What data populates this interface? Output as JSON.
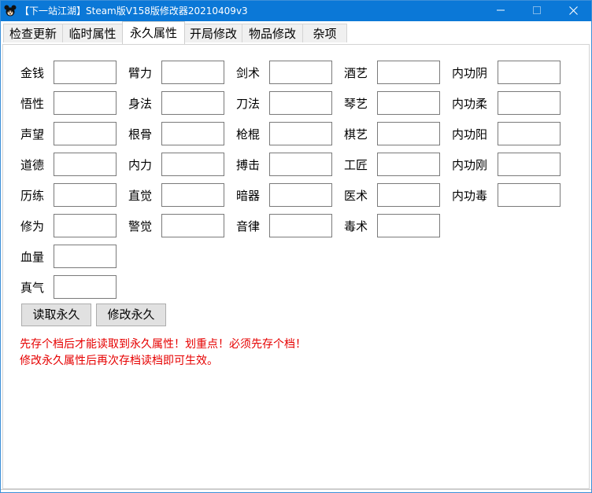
{
  "window": {
    "title": "【下一站江湖】Steam版V158版修改器20210409v3",
    "controls": {
      "minimize_icon": "minimize-icon",
      "maximize_icon": "maximize-icon",
      "close_icon": "close-icon"
    }
  },
  "tabs": [
    {
      "label": "检查更新"
    },
    {
      "label": "临时属性"
    },
    {
      "label": "永久属性",
      "active": true
    },
    {
      "label": "开局修改"
    },
    {
      "label": "物品修改"
    },
    {
      "label": "杂项"
    }
  ],
  "attributes": {
    "col1": [
      "金钱",
      "悟性",
      "声望",
      "道德",
      "历练",
      "修为",
      "血量",
      "真气"
    ],
    "col2": [
      "臂力",
      "身法",
      "根骨",
      "内力",
      "直觉",
      "警觉"
    ],
    "col3": [
      "剑术",
      "刀法",
      "枪棍",
      "搏击",
      "暗器",
      "音律"
    ],
    "col4": [
      "酒艺",
      "琴艺",
      "棋艺",
      "工匠",
      "医术",
      "毒术"
    ],
    "col5": [
      "内功阴",
      "内功柔",
      "内功阳",
      "内功刚",
      "内功毒"
    ]
  },
  "buttons": {
    "read": "读取永久",
    "modify": "修改永久"
  },
  "notice": {
    "line1": "先存个档后才能读取到永久属性！划重点！必须先存个档！",
    "line2": "修改永久属性后再次存档读档即可生效。"
  },
  "colors": {
    "titlebar": "#0b78d7",
    "notice": "#e60000"
  }
}
